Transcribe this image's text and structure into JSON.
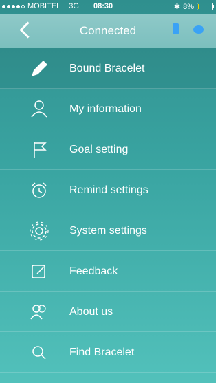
{
  "status_bar": {
    "carrier": "MOBITEL",
    "network": "3G",
    "time": "08:30",
    "battery": "8%",
    "bluetooth_icon": "bluetooth-icon"
  },
  "navbar": {
    "title": "Connected",
    "back_icon": "chevron-left-icon"
  },
  "menu": {
    "items": [
      {
        "label": "Bound Bracelet",
        "icon": "pencil-icon"
      },
      {
        "label": "My information",
        "icon": "person-icon"
      },
      {
        "label": "Goal setting",
        "icon": "flag-icon"
      },
      {
        "label": "Remind settings",
        "icon": "alarm-clock-icon"
      },
      {
        "label": "System settings",
        "icon": "gear-icon"
      },
      {
        "label": "Feedback",
        "icon": "edit-box-icon"
      },
      {
        "label": "About us",
        "icon": "people-icon"
      },
      {
        "label": "Find Bracelet",
        "icon": "search-icon"
      }
    ]
  },
  "colors": {
    "background_top": "#2f8f8e",
    "background_bottom": "#52c1bb",
    "navbar": "#8fc9c8",
    "accent_blue": "#3aa2f5"
  }
}
